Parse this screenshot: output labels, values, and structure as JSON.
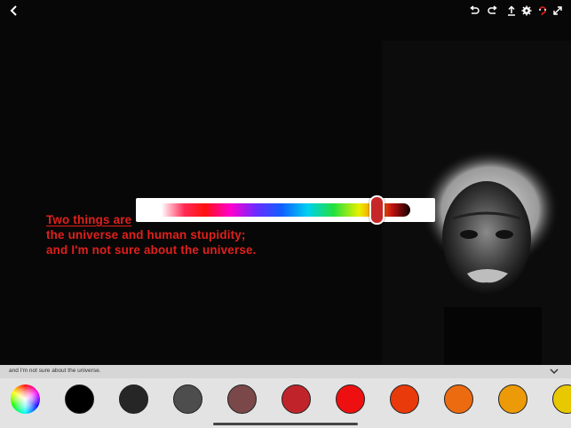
{
  "toolbar": {
    "icons": [
      "back-icon",
      "undo-icon",
      "redo-icon",
      "export-icon",
      "settings-icon",
      "magnet-icon",
      "fullscreen-icon"
    ],
    "accent": "#e0201c"
  },
  "quote": {
    "line1": "Two things are",
    "line2": "the universe and human stupidity;",
    "line3": "and I'm not sure about the universe.",
    "color": "#e0201c"
  },
  "hue_slider": {
    "value": 0.87,
    "thumb_color": "#c62828"
  },
  "panel": {
    "preview_text": "and I'm not sure about the universe."
  },
  "palette": {
    "swatches": [
      "#000000",
      "#262626",
      "#4d4d4d",
      "#7a4848",
      "#c0242a",
      "#ee1010",
      "#e83a0a",
      "#ec6a10",
      "#ec9a08",
      "#e8c800"
    ]
  }
}
